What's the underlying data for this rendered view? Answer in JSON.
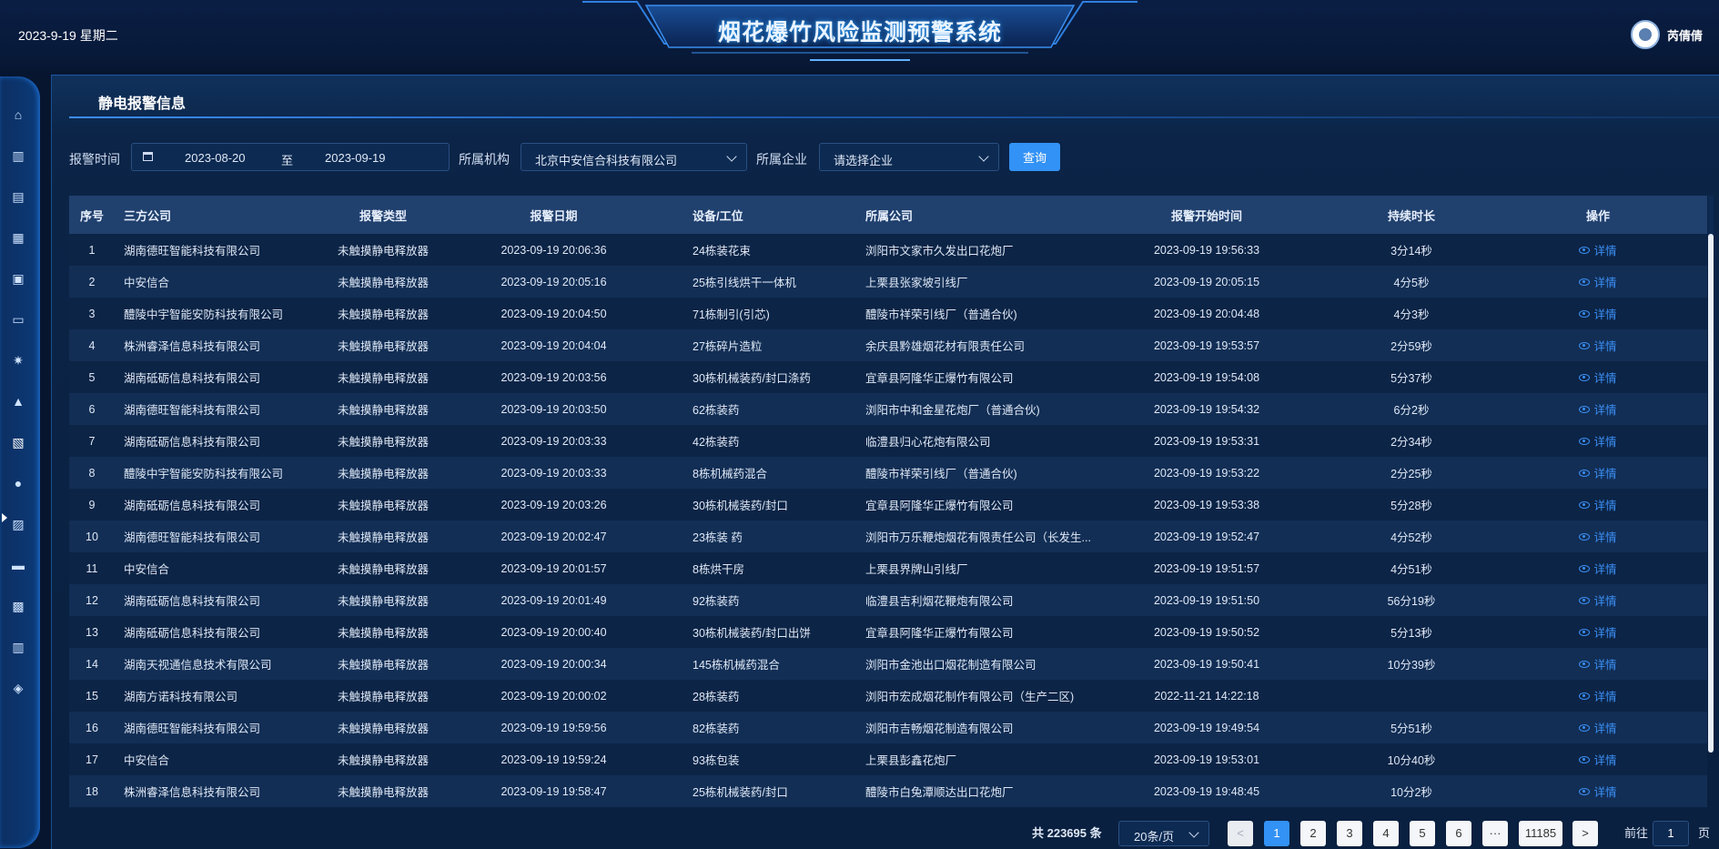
{
  "header": {
    "date": "2023-9-19 星期二",
    "title": "烟花爆竹风险监测预警系统",
    "username": "芮倩倩"
  },
  "sidebar": {
    "icons": [
      "home-icon",
      "building-icon",
      "briefcase-icon",
      "bar-chart-icon",
      "image-card-icon",
      "id-card-icon",
      "alarm-light-icon",
      "warning-icon",
      "document-check-icon",
      "lightbulb-icon",
      "document-settings-icon",
      "monitor-chart-icon",
      "grid-icon",
      "chart-book-icon",
      "layers-icon"
    ],
    "active_index": 8
  },
  "panel": {
    "title": "静电报警信息"
  },
  "filters": {
    "time_label": "报警时间",
    "date_start": "2023-08-20",
    "date_sep": "至",
    "date_end": "2023-09-19",
    "org_label": "所属机构",
    "org_value": "北京中安信合科技有限公司",
    "company_label": "所属企业",
    "company_placeholder": "请选择企业",
    "query_label": "查询"
  },
  "table": {
    "columns": [
      "序号",
      "三方公司",
      "报警类型",
      "报警日期",
      "设备/工位",
      "所属公司",
      "报警开始时间",
      "持续时长",
      "操作"
    ],
    "detail_label": "详情",
    "rows": [
      [
        "1",
        "湖南德旺智能科技有限公司",
        "未触摸静电释放器",
        "2023-09-19 20:06:36",
        "24栋装花束",
        "浏阳市文家市久发出口花炮厂",
        "2023-09-19 19:56:33",
        "3分14秒"
      ],
      [
        "2",
        "中安信合",
        "未触摸静电释放器",
        "2023-09-19 20:05:16",
        "25栋引线烘干一体机",
        "上栗县张家坡引线厂",
        "2023-09-19 20:05:15",
        "4分5秒"
      ],
      [
        "3",
        "醴陵中宇智能安防科技有限公司",
        "未触摸静电释放器",
        "2023-09-19 20:04:50",
        "71栋制引(引芯)",
        "醴陵市祥荣引线厂（普通合伙)",
        "2023-09-19 20:04:48",
        "4分3秒"
      ],
      [
        "4",
        "株洲睿泽信息科技有限公司",
        "未触摸静电释放器",
        "2023-09-19 20:04:04",
        "27栋碎片造粒",
        "余庆县黔雄烟花材有限责任公司",
        "2023-09-19 19:53:57",
        "2分59秒"
      ],
      [
        "5",
        "湖南砥砺信息科技有限公司",
        "未触摸静电释放器",
        "2023-09-19 20:03:56",
        "30栋机械装药/封口涤药",
        "宜章县阿隆华正爆竹有限公司",
        "2023-09-19 19:54:08",
        "5分37秒"
      ],
      [
        "6",
        "湖南德旺智能科技有限公司",
        "未触摸静电释放器",
        "2023-09-19 20:03:50",
        "62栋装药",
        "浏阳市中和金星花炮厂（普通合伙)",
        "2023-09-19 19:54:32",
        "6分2秒"
      ],
      [
        "7",
        "湖南砥砺信息科技有限公司",
        "未触摸静电释放器",
        "2023-09-19 20:03:33",
        "42栋装药",
        "临澧县归心花炮有限公司",
        "2023-09-19 19:53:31",
        "2分34秒"
      ],
      [
        "8",
        "醴陵中宇智能安防科技有限公司",
        "未触摸静电释放器",
        "2023-09-19 20:03:33",
        "8栋机械药混合",
        "醴陵市祥荣引线厂（普通合伙)",
        "2023-09-19 19:53:22",
        "2分25秒"
      ],
      [
        "9",
        "湖南砥砺信息科技有限公司",
        "未触摸静电释放器",
        "2023-09-19 20:03:26",
        "30栋机械装药/封口",
        "宜章县阿隆华正爆竹有限公司",
        "2023-09-19 19:53:38",
        "5分28秒"
      ],
      [
        "10",
        "湖南德旺智能科技有限公司",
        "未触摸静电释放器",
        "2023-09-19 20:02:47",
        "23栋装 药",
        "浏阳市万乐鞭炮烟花有限责任公司（长发生...",
        "2023-09-19 19:52:47",
        "4分52秒"
      ],
      [
        "11",
        "中安信合",
        "未触摸静电释放器",
        "2023-09-19 20:01:57",
        "8栋烘干房",
        "上栗县界牌山引线厂",
        "2023-09-19 19:51:57",
        "4分51秒"
      ],
      [
        "12",
        "湖南砥砺信息科技有限公司",
        "未触摸静电释放器",
        "2023-09-19 20:01:49",
        "92栋装药",
        "临澧县吉利烟花鞭炮有限公司",
        "2023-09-19 19:51:50",
        "56分19秒"
      ],
      [
        "13",
        "湖南砥砺信息科技有限公司",
        "未触摸静电释放器",
        "2023-09-19 20:00:40",
        "30栋机械装药/封口出饼",
        "宜章县阿隆华正爆竹有限公司",
        "2023-09-19 19:50:52",
        "5分13秒"
      ],
      [
        "14",
        "湖南天视通信息技术有限公司",
        "未触摸静电释放器",
        "2023-09-19 20:00:34",
        "145栋机械药混合",
        "浏阳市金池出口烟花制造有限公司",
        "2023-09-19 19:50:41",
        "10分39秒"
      ],
      [
        "15",
        "湖南方诺科技有限公司",
        "未触摸静电释放器",
        "2023-09-19 20:00:02",
        "28栋装药",
        "浏阳市宏成烟花制作有限公司（生产二区)",
        "2022-11-21 14:22:18",
        ""
      ],
      [
        "16",
        "湖南德旺智能科技有限公司",
        "未触摸静电释放器",
        "2023-09-19 19:59:56",
        "82栋装药",
        "浏阳市吉畅烟花制造有限公司",
        "2023-09-19 19:49:54",
        "5分51秒"
      ],
      [
        "17",
        "中安信合",
        "未触摸静电释放器",
        "2023-09-19 19:59:24",
        "93栋包装",
        "上栗县彭鑫花炮厂",
        "2023-09-19 19:53:01",
        "10分40秒"
      ],
      [
        "18",
        "株洲睿泽信息科技有限公司",
        "未触摸静电释放器",
        "2023-09-19 19:58:47",
        "25栋机械装药/封口",
        "醴陵市白兔潭顺达出口花炮厂",
        "2023-09-19 19:48:45",
        "10分2秒"
      ]
    ]
  },
  "pagination": {
    "total_text": "共 223695 条",
    "page_size": "20条/页",
    "prev": "<",
    "next": ">",
    "pages": [
      "1",
      "2",
      "3",
      "4",
      "5",
      "6",
      "···",
      "11185"
    ],
    "current": "1",
    "jump_label": "前往",
    "jump_value": "1",
    "jump_suffix": "页"
  }
}
